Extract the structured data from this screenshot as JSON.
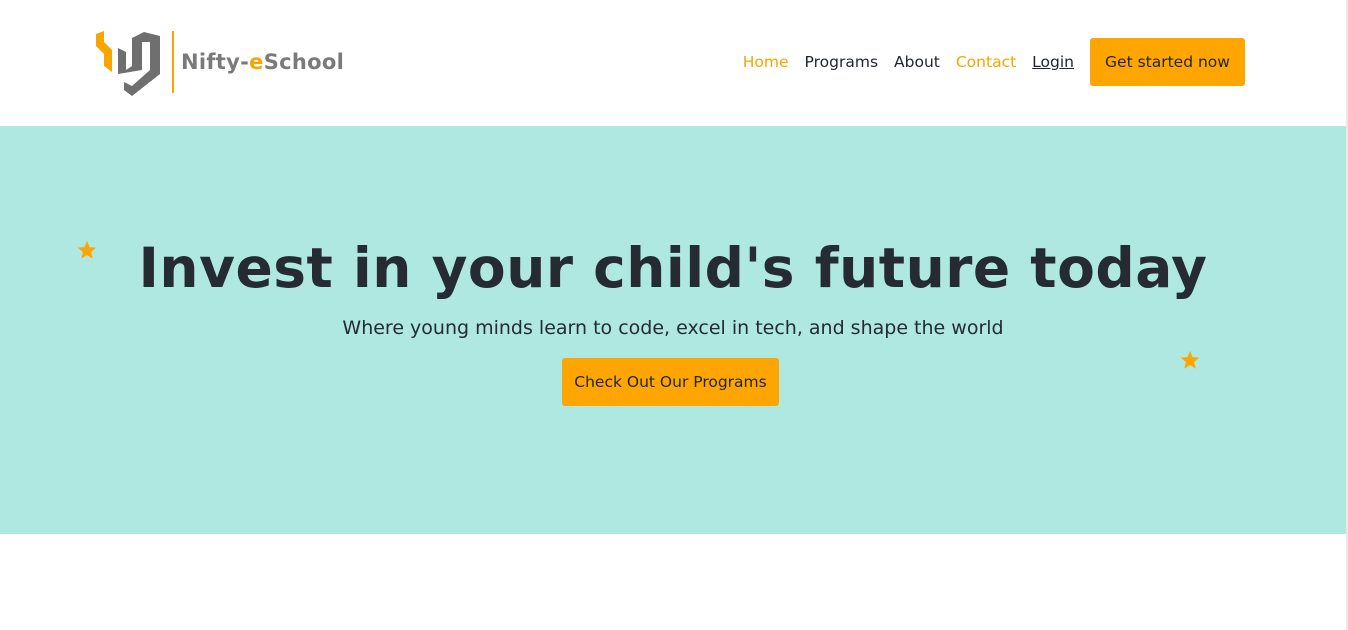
{
  "header": {
    "logo_text_part1": "Nifty-",
    "logo_text_accent": "e",
    "logo_text_part2": "School",
    "nav": [
      {
        "label": "Home",
        "active": true
      },
      {
        "label": "Programs",
        "active": false
      },
      {
        "label": "About",
        "active": false
      },
      {
        "label": "Contact",
        "active": true
      },
      {
        "label": "Login",
        "active": false
      }
    ],
    "cta_label": "Get started now"
  },
  "hero": {
    "title": "Invest in your child's future today",
    "subtitle": "Where young minds learn to code, excel in tech, and shape the world",
    "cta_label": "Check Out Our Programs"
  },
  "icons": [
    "logo-icon",
    "star-icon",
    "star-icon"
  ],
  "colors": {
    "brand_orange": "#ffa500",
    "hero_background": "#aee8e1",
    "logo_gray": "#7a7a7a",
    "text_dark": "#252a33"
  }
}
